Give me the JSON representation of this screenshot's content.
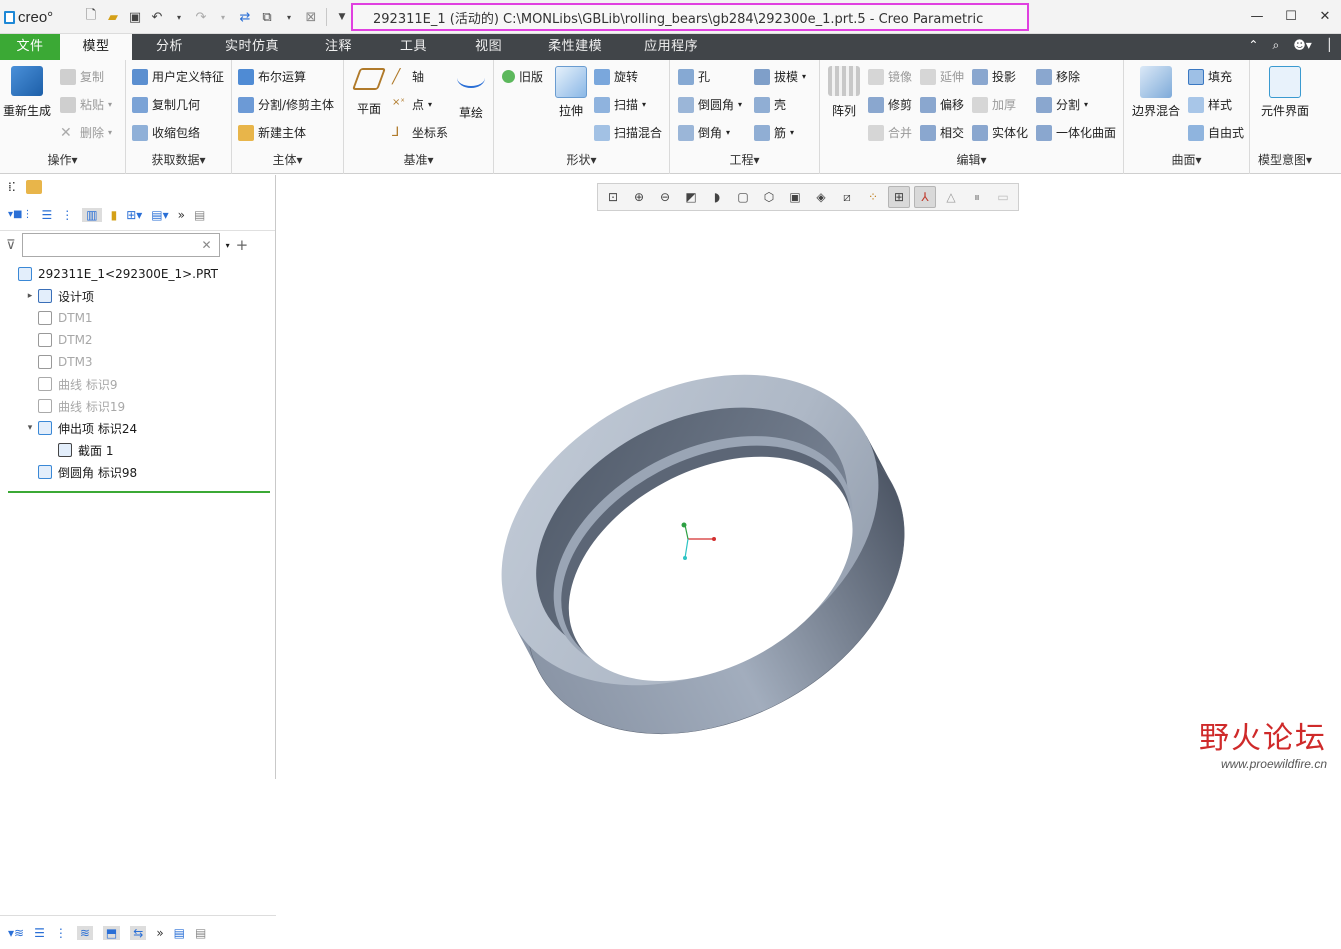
{
  "app": {
    "logo": "creo°"
  },
  "window": {
    "title": "292311E_1 (活动的) C:\\MONLibs\\GBLib\\rolling_bears\\gb284\\292300e_1.prt.5 - Creo Parametric"
  },
  "tabs": [
    "文件",
    "模型",
    "分析",
    "实时仿真",
    "注释",
    "工具",
    "视图",
    "柔性建模",
    "应用程序"
  ],
  "ribbon": {
    "operations": {
      "label": "操作▾",
      "regen": "重新生成",
      "copy": "复制",
      "paste": "粘贴",
      "delete": "删除"
    },
    "getdata": {
      "label": "获取数据▾",
      "udf": "用户定义特征",
      "copygeom": "复制几何",
      "shrinkwrap": "收缩包络"
    },
    "body": {
      "label": "主体▾",
      "boolean": "布尔运算",
      "split": "分割/修剪主体",
      "newbody": "新建主体"
    },
    "datum": {
      "label": "基准▾",
      "plane": "平面",
      "axis": "轴",
      "point": "点",
      "csys": "坐标系",
      "sketch": "草绘"
    },
    "shapes": {
      "label": "形状▾",
      "legacy": "旧版",
      "extrude": "拉伸",
      "revolve": "旋转",
      "sweep": "扫描",
      "sweepblend": "扫描混合"
    },
    "engineering": {
      "label": "工程▾",
      "hole": "孔",
      "round": "倒圆角",
      "chamfer": "倒角",
      "draft": "拔模",
      "shell": "壳",
      "rib": "筋"
    },
    "editing": {
      "label": "编辑▾",
      "pattern": "阵列",
      "mirror": "镜像",
      "extend": "延伸",
      "project": "投影",
      "remove": "移除",
      "trim": "修剪",
      "offset": "偏移",
      "thicken": "加厚",
      "split": "分割",
      "merge": "合并",
      "intersect": "相交",
      "solidify": "实体化",
      "unify": "一体化曲面"
    },
    "surfaces": {
      "label": "曲面▾",
      "boundary": "边界混合",
      "fill": "填充",
      "style": "样式",
      "freestyle": "自由式"
    },
    "intent": {
      "label": "模型意图▾",
      "component": "元件界面"
    }
  },
  "tree": {
    "filter_placeholder": "",
    "items": [
      {
        "label": "292311E_1<292300E_1>.PRT",
        "dim": false,
        "indent": 0,
        "twisty": ""
      },
      {
        "label": "设计项",
        "dim": false,
        "indent": 1,
        "twisty": "▸"
      },
      {
        "label": "DTM1",
        "dim": true,
        "indent": 1,
        "twisty": ""
      },
      {
        "label": "DTM2",
        "dim": true,
        "indent": 1,
        "twisty": ""
      },
      {
        "label": "DTM3",
        "dim": true,
        "indent": 1,
        "twisty": ""
      },
      {
        "label": "曲线 标识9",
        "dim": true,
        "indent": 1,
        "twisty": ""
      },
      {
        "label": "曲线 标识19",
        "dim": true,
        "indent": 1,
        "twisty": ""
      },
      {
        "label": "伸出项 标识24",
        "dim": false,
        "indent": 1,
        "twisty": "▾"
      },
      {
        "label": "截面 1",
        "dim": false,
        "indent": 2,
        "twisty": ""
      },
      {
        "label": "倒圆角 标识98",
        "dim": false,
        "indent": 1,
        "twisty": ""
      }
    ]
  },
  "watermark": {
    "text": "野火论坛",
    "url": "www.proewildfire.cn"
  },
  "colors": {
    "tab_active_file": "#3ba935",
    "tabbar": "#414549",
    "title_highlight": "#e040e0",
    "part": "#9aa5b5"
  }
}
